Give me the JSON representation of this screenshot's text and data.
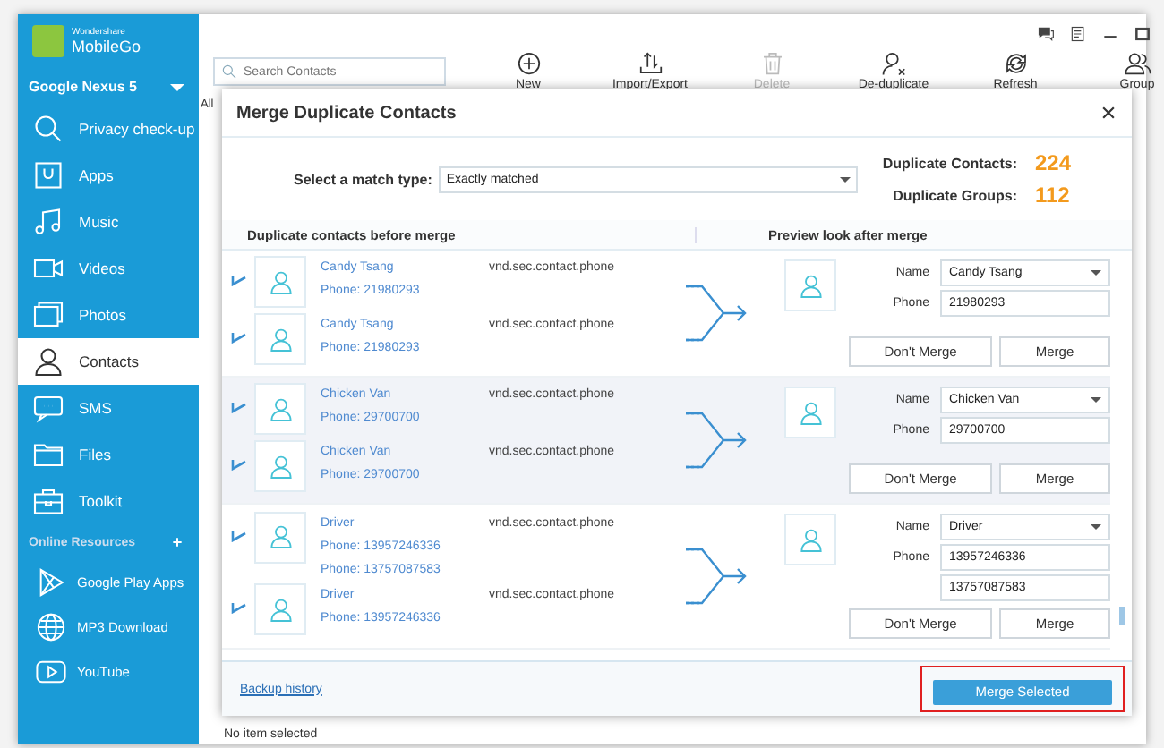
{
  "app": {
    "maker": "Wondershare",
    "product": "MobileGo",
    "device": "Google Nexus 5"
  },
  "sidebar": {
    "items": [
      {
        "label": "Privacy check-up",
        "selected": false
      },
      {
        "label": "Apps",
        "selected": false
      },
      {
        "label": "Music",
        "selected": false
      },
      {
        "label": "Videos",
        "selected": false
      },
      {
        "label": "Photos",
        "selected": false
      },
      {
        "label": "Contacts",
        "selected": true
      },
      {
        "label": "SMS",
        "selected": false
      },
      {
        "label": "Files",
        "selected": false
      },
      {
        "label": "Toolkit",
        "selected": false
      }
    ],
    "section_title": "Online Resources",
    "resources": [
      {
        "label": "Google Play Apps"
      },
      {
        "label": "MP3 Download"
      },
      {
        "label": "YouTube"
      }
    ]
  },
  "main": {
    "search": {
      "placeholder": "Search Contacts"
    },
    "toolbar": [
      {
        "label": "New",
        "disabled": false
      },
      {
        "label": "Import/Export",
        "disabled": false
      },
      {
        "label": "Delete",
        "disabled": true
      },
      {
        "label": "De-duplicate",
        "disabled": false
      },
      {
        "label": "Refresh",
        "disabled": false
      },
      {
        "label": "Group",
        "disabled": false
      }
    ],
    "tab": "All",
    "status_bar": "No item selected"
  },
  "dialog": {
    "title": "Merge Duplicate Contacts",
    "match_label": "Select a match type:",
    "match_value": "Exactly matched",
    "stats": [
      {
        "label": "Duplicate Contacts:",
        "value": "224"
      },
      {
        "label": "Duplicate Groups:",
        "value": "112"
      }
    ],
    "columns": [
      "Duplicate contacts before merge",
      "Preview look after merge"
    ],
    "groups": [
      {
        "selected": false,
        "entries": [
          {
            "checked": true,
            "name": "Candy Tsang",
            "phones": [
              "Phone: 21980293"
            ],
            "type": "vnd.sec.contact.phone"
          },
          {
            "checked": true,
            "name": "Candy Tsang",
            "phones": [
              "Phone: 21980293"
            ],
            "type": "vnd.sec.contact.phone"
          }
        ],
        "preview": {
          "name_label": "Name",
          "name": "Candy Tsang",
          "phone_label": "Phone",
          "phones": [
            "21980293"
          ]
        },
        "buttons": [
          "Don't Merge",
          "Merge"
        ]
      },
      {
        "selected": true,
        "entries": [
          {
            "checked": true,
            "name": "Chicken Van",
            "phones": [
              "Phone: 29700700"
            ],
            "type": "vnd.sec.contact.phone"
          },
          {
            "checked": true,
            "name": "Chicken Van",
            "phones": [
              "Phone: 29700700"
            ],
            "type": "vnd.sec.contact.phone"
          }
        ],
        "preview": {
          "name_label": "Name",
          "name": "Chicken Van",
          "phone_label": "Phone",
          "phones": [
            "29700700"
          ]
        },
        "buttons": [
          "Don't Merge",
          "Merge"
        ]
      },
      {
        "selected": false,
        "entries": [
          {
            "checked": true,
            "name": "Driver",
            "phones": [
              "Phone: 13957246336",
              "Phone: 13757087583"
            ],
            "type": "vnd.sec.contact.phone"
          },
          {
            "checked": true,
            "name": "Driver",
            "phones": [
              "Phone: 13957246336"
            ],
            "type": "vnd.sec.contact.phone"
          }
        ],
        "preview": {
          "name_label": "Name",
          "name": "Driver",
          "phone_label": "Phone",
          "phones": [
            "13957246336",
            "13757087583"
          ]
        },
        "buttons": [
          "Don't Merge",
          "Merge"
        ]
      }
    ],
    "footer_link": "Backup history",
    "primary_button": {
      "label": "Merge Selected",
      "outlined": true
    }
  }
}
